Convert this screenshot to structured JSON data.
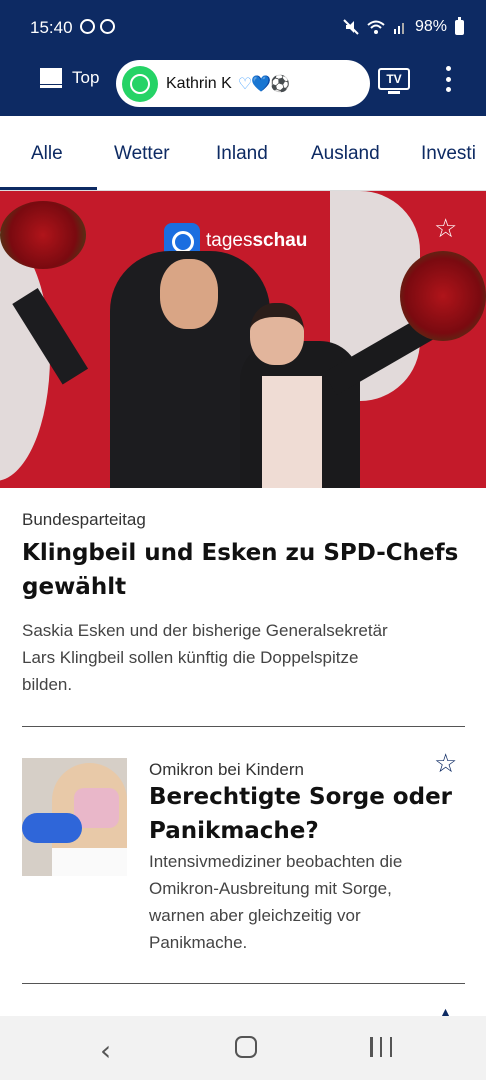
{
  "status_bar": {
    "time": "15:40",
    "battery": "98%"
  },
  "app_bar": {
    "top_label": "Top",
    "chat_name": "Kathrin K",
    "chat_extra": "♡💙⚽",
    "tv_label": "TV"
  },
  "tabs": [
    {
      "label": "Alle"
    },
    {
      "label": "Wetter"
    },
    {
      "label": "Inland"
    },
    {
      "label": "Ausland"
    },
    {
      "label": "Investi"
    }
  ],
  "hero": {
    "logo_left": "tages",
    "logo_right": "schau"
  },
  "articles": [
    {
      "kicker": "Bundesparteitag",
      "headline_line1": "Klingbeil und Esken zu SPD-Chefs",
      "headline_line2": "gewählt",
      "summary_line1": "Saskia Esken und der bisherige Generalsekretär",
      "summary_line2": "Lars Klingbeil sollen künftig die Doppelspitze",
      "summary_line3": "bilden."
    },
    {
      "kicker": "Omikron bei Kindern",
      "headline_line1": "Berechtigte Sorge oder",
      "headline_line2": "Panikmache?",
      "summary_line1": "Intensivmediziner beobachten die",
      "summary_line2": "Omikron-Ausbreitung mit Sorge,",
      "summary_line3": "warnen aber gleichzeitig vor",
      "summary_line4": "Panikmache."
    }
  ],
  "colors": {
    "brand_navy": "#0d2a63",
    "hero_red": "#c41a2a",
    "whatsapp_green": "#25d366"
  }
}
